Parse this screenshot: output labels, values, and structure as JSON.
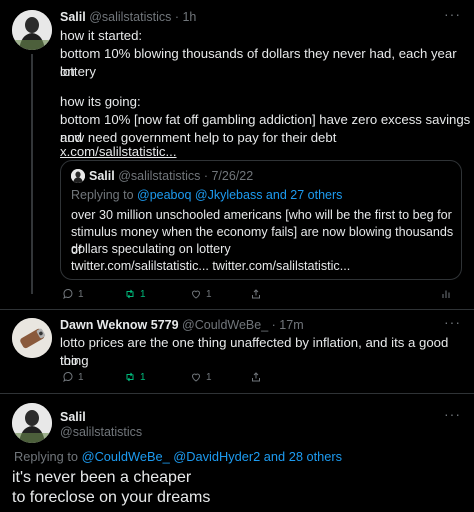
{
  "tweet1": {
    "name": "Salil",
    "handle": "@salilstatistics",
    "time": "· 1h",
    "lines": [
      "how it started:",
      "bottom 10% blowing thousands of dollars they never had, each year on",
      "lottery",
      "",
      "how its going:",
      "bottom 10% [now fat off gambling addiction] have zero excess savings and",
      "now need government help to pay for their debt"
    ],
    "link": "x.com/salilstatistic...",
    "quote": {
      "name": "Salil",
      "handle": "@salilstatistics",
      "time": "· 7/26/22",
      "replying_prefix": "Replying to ",
      "replying_targets": "@peaboq @Jkylebass and 27 others",
      "lines": [
        "over 30 million unschooled americans [who will be the first to beg for",
        "stimulus money when the economy fails] are now blowing thousands of",
        "dollars speculating on lottery",
        "twitter.com/salilstatistic... twitter.com/salilstatistic..."
      ]
    },
    "actions": {
      "replies": "1",
      "retweets": "1",
      "likes": "1"
    },
    "more": "···"
  },
  "tweet2": {
    "name": "Dawn Weknow 5779",
    "handle": "@CouldWeBe_",
    "time": "· 17m",
    "lines": [
      "lotto prices are the one thing unaffected by inflation, and its a good thing",
      "too"
    ],
    "actions": {
      "replies": "1",
      "retweets": "1",
      "likes": "1"
    },
    "more": "···"
  },
  "tweet3": {
    "name": "Salil",
    "handle": "@salilstatistics",
    "replying_prefix": "Replying to ",
    "replying_targets": "@CouldWeBe_ @DavidHyder2 and 28 others",
    "lines": [
      "it's never been a cheaper",
      "to foreclose on your dreams"
    ],
    "more": "···"
  },
  "colors": {
    "background": "#000000",
    "text": "#e7e9ea",
    "muted": "#71767b",
    "link": "#1d9bf0",
    "retweet_active": "#00ba7c",
    "border": "#2f3336"
  }
}
